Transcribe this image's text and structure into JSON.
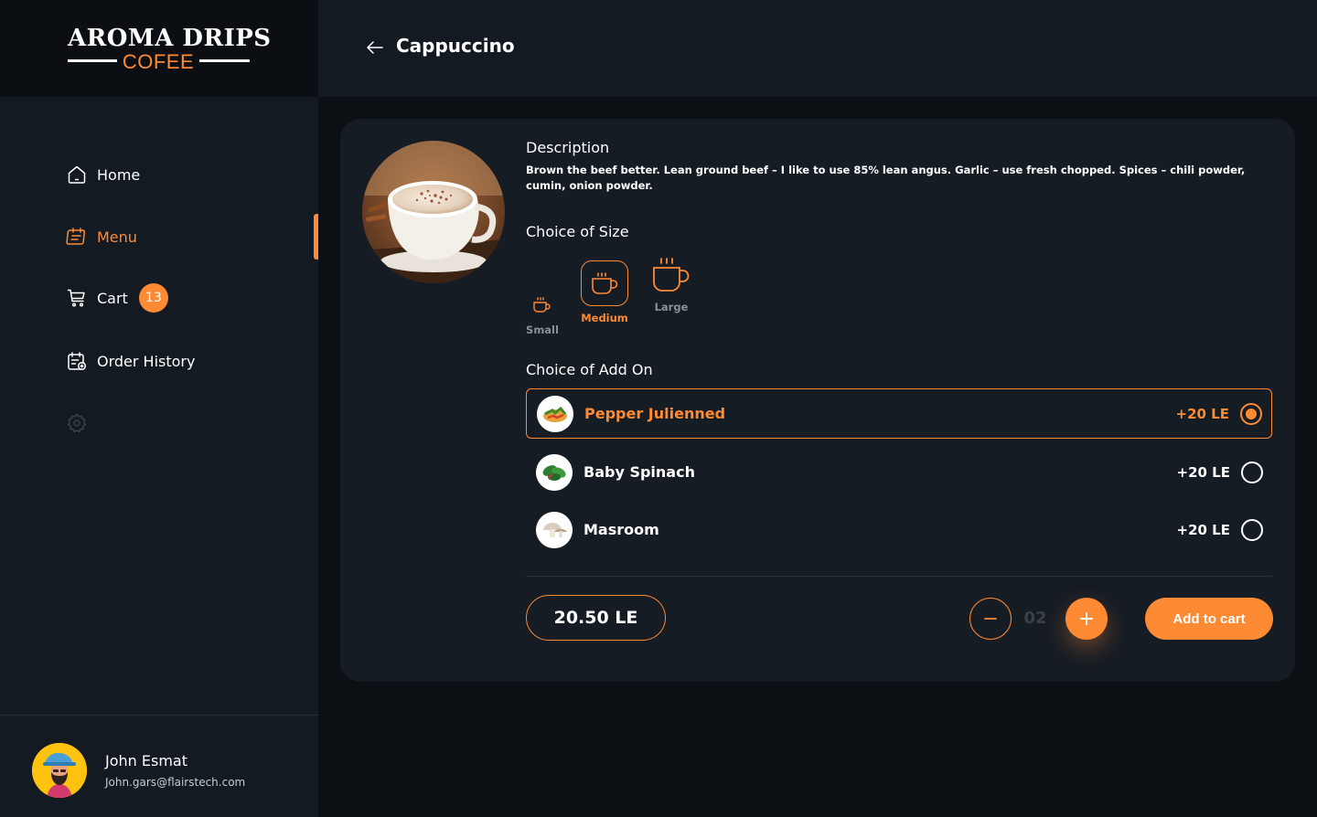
{
  "brand": {
    "line1": "AROMA DRIPS",
    "line2": "COFEE"
  },
  "sidebar": {
    "items": [
      {
        "label": "Home",
        "icon": "home-icon"
      },
      {
        "label": "Menu",
        "icon": "menu-icon",
        "active": true
      },
      {
        "label": "Cart",
        "icon": "cart-icon",
        "badge": "13"
      },
      {
        "label": "Order History",
        "icon": "order-history-icon"
      }
    ],
    "settings_icon": "gear-icon"
  },
  "user": {
    "name": "John Esmat",
    "email": "John.gars@flairstech.com"
  },
  "header": {
    "title": "Cappuccino"
  },
  "product": {
    "description_title": "Description",
    "description": "Brown the beef better. Lean ground beef – I like to use 85% lean angus. Garlic – use fresh  chopped. Spices – chili powder, cumin, onion powder.",
    "size_title": "Choice of Size",
    "sizes": [
      {
        "label": "Small"
      },
      {
        "label": "Medium",
        "selected": true
      },
      {
        "label": "Large"
      }
    ],
    "addon_title": "Choice of Add On",
    "addons": [
      {
        "name": "Pepper Julienned",
        "price": "+20 LE",
        "selected": true
      },
      {
        "name": "Baby Spinach",
        "price": "+20 LE"
      },
      {
        "name": "Masroom",
        "price": "+20 LE"
      }
    ],
    "price": "20.50 LE",
    "quantity": "02",
    "add_to_cart": "Add to cart"
  },
  "colors": {
    "accent": "#ff8a34",
    "background": "#0c0f13",
    "panel": "#141a21",
    "card": "#161c24"
  }
}
